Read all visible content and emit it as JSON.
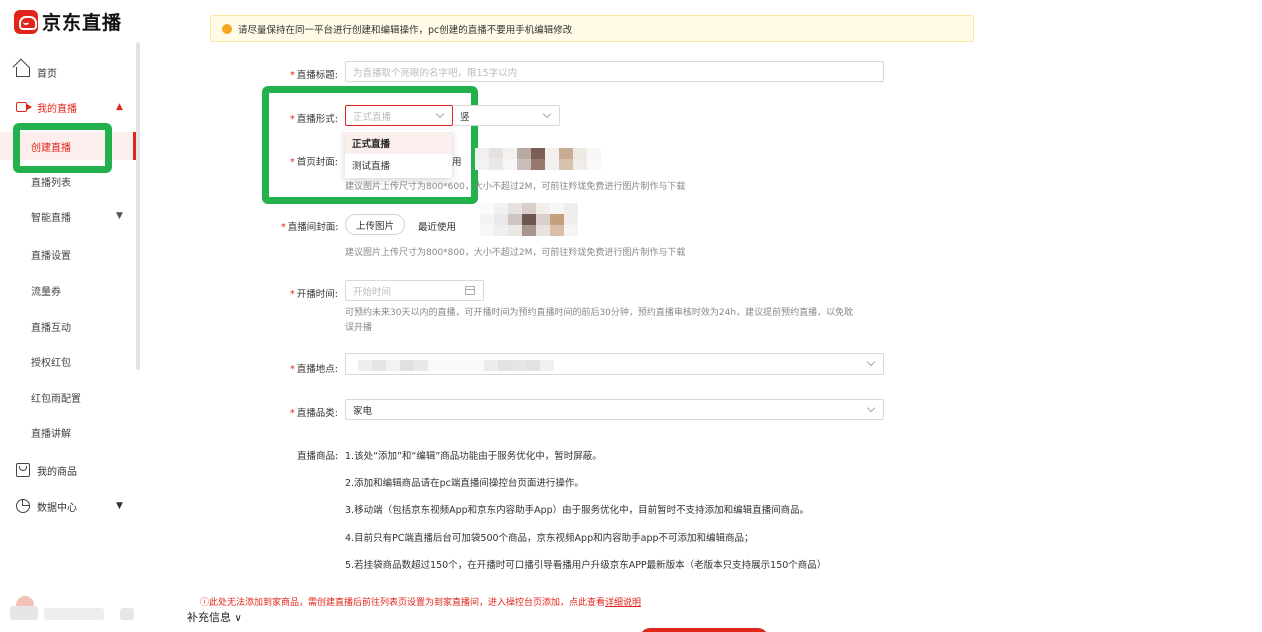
{
  "brand": {
    "name": "京东直播",
    "color": "#e1251b"
  },
  "sidebar": {
    "home": "首页",
    "my_live": "我的直播",
    "sub_items": [
      "创建直播",
      "直播列表",
      "智能直播",
      "直播设置",
      "流量券",
      "直播互动",
      "授权红包",
      "红包雨配置",
      "直播讲解"
    ],
    "my_goods": "我的商品",
    "data_center": "数据中心"
  },
  "notice": {
    "text": "请尽量保持在同一平台进行创建和编辑操作，pc创建的直播不要用手机编辑修改"
  },
  "form": {
    "title": {
      "label": "直播标题:",
      "placeholder": "为直播取个亮眼的名字吧，限15字以内"
    },
    "format": {
      "label": "直播形式:",
      "placeholder": "正式直播",
      "options": [
        "正式直播",
        "测试直播"
      ],
      "second_select_prefix": "竖"
    },
    "cover": {
      "label": "首页封面:",
      "recent_suffix": "用",
      "hint": "建议图片上传尺寸为800*600，大小不超过2M，可前往羚珑免费进行图片制作与下载"
    },
    "room_cover": {
      "label": "直播间封面:",
      "upload": "上传图片",
      "recent": "最近使用",
      "hint": "建议图片上传尺寸为800*800，大小不超过2M，可前往羚珑免费进行图片制作与下载"
    },
    "start_time": {
      "label": "开播时间:",
      "placeholder": "开始时间",
      "hint_line1": "可预约未来30天以内的直播，可开播时间为预约直播时间的前后30分钟，预约直播审核时效为24h，建议提前预约直播，以免耽",
      "hint_line2": "误开播"
    },
    "location": {
      "label": "直播地点:"
    },
    "category": {
      "label": "直播品类:",
      "value": "家电"
    },
    "goods": {
      "label": "直播商品:",
      "lines": [
        "1.该处“添加”和“编辑”商品功能由于服务优化中，暂时屏蔽。",
        "2.添加和编辑商品请在pc端直播间操控台页面进行操作。",
        "3.移动端（包括京东视频App和京东内容助手App）由于服务优化中，目前暂时不支持添加和编辑直播间商品。",
        "4.目前只有PC端直播后台可加袋500个商品，京东视频App和内容助手app不可添加和编辑商品；",
        "5.若挂袋商品数超过150个，在开播时可口播引导看播用户升级京东APP最新版本（老版本只支持展示150个商品）"
      ]
    },
    "warning": {
      "text": "此处无法添加到家商品，需创建直播后前往列表页设置为到家直播间，进入操控台页添加，点此查看",
      "link": "详细说明"
    },
    "supplement": "补充信息"
  }
}
